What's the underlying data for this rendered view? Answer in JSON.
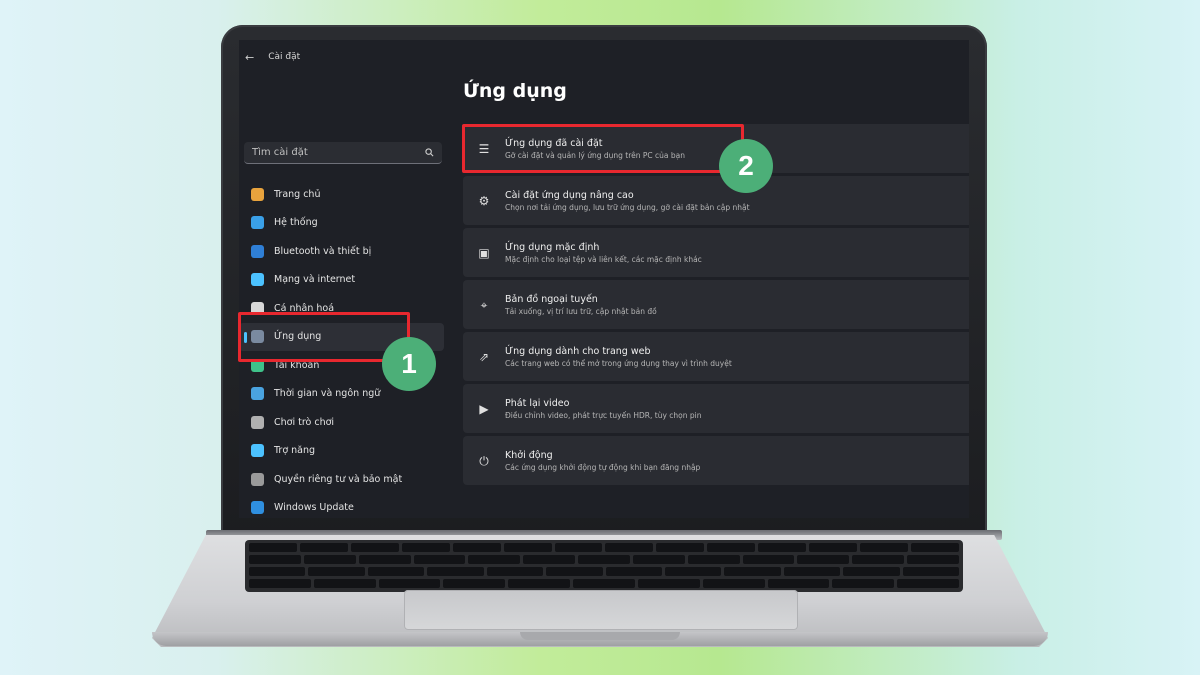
{
  "window": {
    "title": "Cài đặt"
  },
  "search": {
    "placeholder": "Tìm cài đặt"
  },
  "sidebar": {
    "items": [
      {
        "label": "Trang chủ",
        "icon": "home-icon",
        "color": "#e8a33d"
      },
      {
        "label": "Hệ thống",
        "icon": "monitor-icon",
        "color": "#3aa0e8"
      },
      {
        "label": "Bluetooth và thiết bị",
        "icon": "bluetooth-icon",
        "color": "#2f7fd6"
      },
      {
        "label": "Mạng và internet",
        "icon": "wifi-icon",
        "color": "#4cc2ff"
      },
      {
        "label": "Cá nhân hoá",
        "icon": "brush-icon",
        "color": "#d8d8d8"
      },
      {
        "label": "Ứng dụng",
        "icon": "apps-icon",
        "color": "#7a8aa0",
        "active": true
      },
      {
        "label": "Tài khoản",
        "icon": "account-icon",
        "color": "#3fc28a"
      },
      {
        "label": "Thời gian và ngôn ngữ",
        "icon": "globe-clock-icon",
        "color": "#4aa3e0"
      },
      {
        "label": "Chơi trò chơi",
        "icon": "gamepad-icon",
        "color": "#b0b0b0"
      },
      {
        "label": "Trợ năng",
        "icon": "accessibility-icon",
        "color": "#4cc2ff"
      },
      {
        "label": "Quyền riêng tư và bảo mật",
        "icon": "shield-icon",
        "color": "#9a9a9a"
      },
      {
        "label": "Windows Update",
        "icon": "update-icon",
        "color": "#2f8fe0"
      }
    ]
  },
  "main": {
    "title": "Ứng dụng",
    "cards": [
      {
        "title": "Ứng dụng đã cài đặt",
        "desc": "Gỡ cài đặt và quản lý ứng dụng trên PC của bạn",
        "icon": "list-icon"
      },
      {
        "title": "Cài đặt ứng dụng nâng cao",
        "desc": "Chọn nơi tải ứng dụng, lưu trữ ứng dụng, gỡ cài đặt bản cập nhật",
        "icon": "app-settings-icon"
      },
      {
        "title": "Ứng dụng mặc định",
        "desc": "Mặc định cho loại tệp và liên kết, các mặc định khác",
        "icon": "default-apps-icon"
      },
      {
        "title": "Bản đồ ngoại tuyến",
        "desc": "Tải xuống, vị trí lưu trữ, cập nhật bản đồ",
        "icon": "map-icon"
      },
      {
        "title": "Ứng dụng dành cho trang web",
        "desc": "Các trang web có thể mở trong ứng dụng thay vì trình duyệt",
        "icon": "web-app-icon"
      },
      {
        "title": "Phát lại video",
        "desc": "Điều chỉnh video, phát trực tuyến HDR, tùy chọn pin",
        "icon": "video-icon"
      },
      {
        "title": "Khởi động",
        "desc": "Các ứng dụng khởi động tự động khi bạn đăng nhập",
        "icon": "startup-icon"
      }
    ]
  },
  "annotations": {
    "step1": "1",
    "step2": "2",
    "highlight_color": "#e8282f",
    "badge_color": "#4caf78"
  }
}
